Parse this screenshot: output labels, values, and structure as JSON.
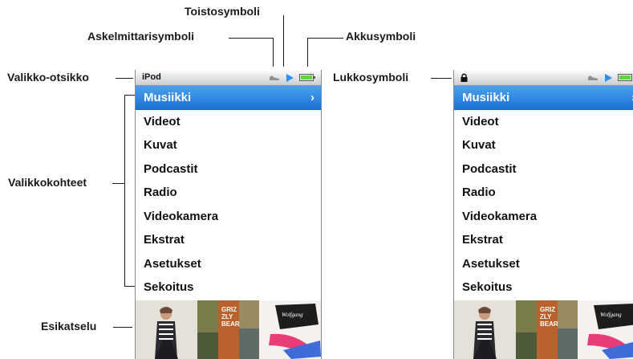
{
  "callouts": {
    "toistosymboli": "Toistosymboli",
    "askelmittarisymboli": "Askelmittarisymboli",
    "akkusymboli": "Akkusymboli",
    "valikko_otsikko": "Valikko-otsikko",
    "lukkosymboli": "Lukkosymboli",
    "valikkokohteet": "Valikkokohteet",
    "esikatselu": "Esikatselu"
  },
  "screen_left": {
    "title": "iPod",
    "selected_index": 0,
    "items": [
      "Musiikki",
      "Videot",
      "Kuvat",
      "Podcastit",
      "Radio",
      "Videokamera",
      "Ekstrat",
      "Asetukset",
      "Sekoitus"
    ]
  },
  "screen_right": {
    "selected_index": 0,
    "items": [
      "Musiikki",
      "Videot",
      "Kuvat",
      "Podcastit",
      "Radio",
      "Videokamera",
      "Ekstrat",
      "Asetukset",
      "Sekoitus"
    ]
  },
  "icons": {
    "lock": "lock-icon",
    "pedometer": "shoe-icon",
    "play": "play-icon",
    "battery": "battery-icon",
    "chevron": "chevron-right-icon"
  },
  "colors": {
    "selection": "#2a86e6",
    "battery_fill": "#5cd63c",
    "play_icon": "#2f8ff0",
    "shoe_icon": "#8e9196"
  }
}
